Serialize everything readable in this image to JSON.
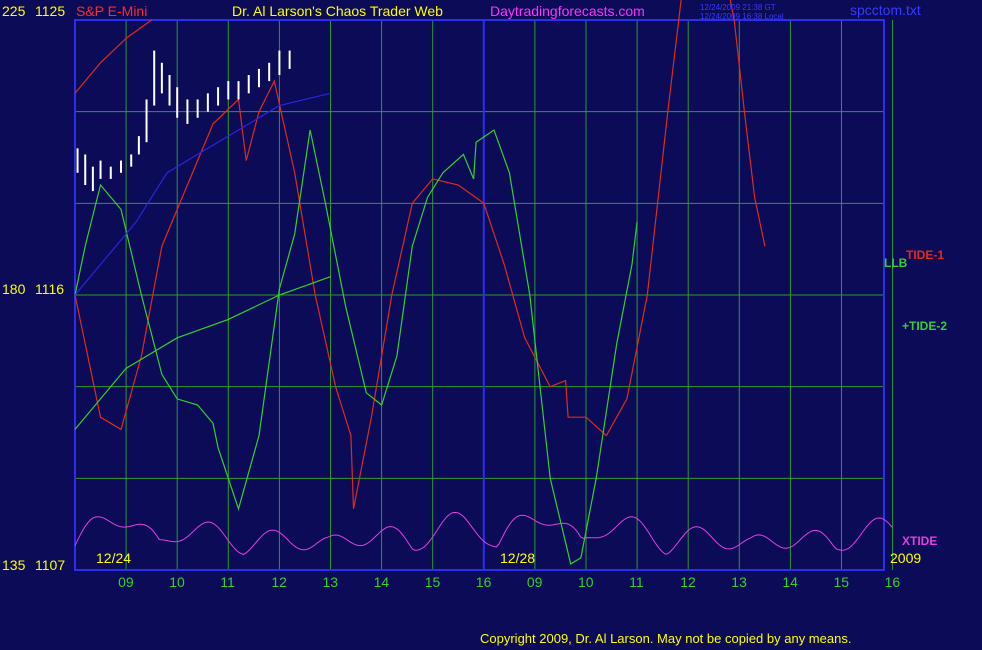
{
  "header": {
    "instrument": "S&P E-Mini",
    "title": "Dr. Al Larson's Chaos Trader Web",
    "site": "Daytradingforecasts.com",
    "timestamp_1": "12/24/2009 21:38 GT",
    "timestamp_2": "12/24/2009 16:38 Local",
    "filename": "spcctom.txt"
  },
  "footer": {
    "copyright": "Copyright 2009, Dr. Al Larson. May not be copied by any means."
  },
  "colors": {
    "background": "#0b0b57",
    "grid": "#2e9a2e",
    "frame": "#2d2df0",
    "tide1": "#e02b1c",
    "tide2": "#34d02f",
    "xtide": "#e040e0",
    "llb": "#2727e0",
    "price": "#ffffff",
    "elements": "#ffff00"
  },
  "chart_data": {
    "type": "line",
    "y_left_labels": [
      {
        "scale": "225",
        "price": "1125"
      },
      {
        "scale": "180",
        "price": "1116"
      },
      {
        "scale": "135",
        "price": "1107"
      }
    ],
    "price_range": [
      1107,
      1125
    ],
    "scale_range": [
      135,
      225
    ],
    "date_labels": [
      "12/24",
      "12/28",
      "2009"
    ],
    "hour_ticks": [
      "09",
      "10",
      "11",
      "12",
      "13",
      "14",
      "15",
      "16",
      "09",
      "10",
      "11",
      "12",
      "13",
      "14",
      "15",
      "16"
    ],
    "tick_index": [
      0,
      1,
      2,
      3,
      4,
      5,
      6,
      7,
      8,
      9,
      10,
      11,
      12,
      13,
      14,
      15
    ],
    "series_labels": {
      "tide1": "TIDE-1",
      "tide2": "+TIDE-2",
      "llb": "LLB",
      "xtide": "XTIDE"
    },
    "tide1": [
      [
        0,
        180
      ],
      [
        0.25,
        170
      ],
      [
        0.5,
        160
      ],
      [
        0.9,
        158
      ],
      [
        1.3,
        170
      ],
      [
        1.7,
        188
      ],
      [
        2.2,
        198
      ],
      [
        2.7,
        208
      ],
      [
        3.2,
        212
      ],
      [
        3.35,
        202
      ],
      [
        3.6,
        210
      ],
      [
        3.9,
        215
      ],
      [
        4.3,
        200
      ],
      [
        4.7,
        180
      ],
      [
        5.1,
        165
      ],
      [
        5.4,
        157
      ],
      [
        5.45,
        145
      ],
      [
        5.8,
        160
      ],
      [
        6.2,
        180
      ],
      [
        6.6,
        195
      ],
      [
        7.0,
        199
      ],
      [
        7.5,
        198
      ],
      [
        8.0,
        195
      ],
      [
        8.4,
        185
      ],
      [
        8.8,
        173
      ],
      [
        9.3,
        165
      ],
      [
        9.6,
        166
      ],
      [
        9.65,
        160
      ],
      [
        10.0,
        160
      ],
      [
        10.4,
        157
      ],
      [
        10.8,
        163
      ],
      [
        11.2,
        180
      ],
      [
        11.6,
        210
      ],
      [
        12.0,
        238
      ],
      [
        12.5,
        242
      ],
      [
        12.9,
        225
      ],
      [
        13.1,
        210
      ],
      [
        13.3,
        196
      ],
      [
        13.5,
        188
      ]
    ],
    "tide2": [
      [
        0,
        180
      ],
      [
        0.2,
        188
      ],
      [
        0.5,
        198
      ],
      [
        0.9,
        194
      ],
      [
        1.3,
        180
      ],
      [
        1.7,
        167
      ],
      [
        2.0,
        163
      ],
      [
        2.4,
        162
      ],
      [
        2.7,
        159
      ],
      [
        2.8,
        155
      ],
      [
        3.2,
        145
      ],
      [
        3.6,
        157
      ],
      [
        4.0,
        181
      ],
      [
        4.3,
        190
      ],
      [
        4.6,
        207
      ],
      [
        4.9,
        195
      ],
      [
        5.3,
        178
      ],
      [
        5.7,
        164
      ],
      [
        6.0,
        162
      ],
      [
        6.3,
        170
      ],
      [
        6.6,
        188
      ],
      [
        6.9,
        196
      ],
      [
        7.2,
        200
      ],
      [
        7.6,
        203
      ],
      [
        7.8,
        199
      ],
      [
        7.85,
        205
      ],
      [
        8.2,
        207
      ],
      [
        8.5,
        200
      ],
      [
        8.9,
        180
      ],
      [
        9.3,
        150
      ],
      [
        9.7,
        136
      ],
      [
        9.9,
        137
      ],
      [
        10.2,
        150
      ],
      [
        10.6,
        172
      ],
      [
        10.9,
        185
      ],
      [
        11.0,
        192
      ]
    ],
    "xtide_hint": "oscillating magenta series along chart bottom",
    "price_bars_note": "price candles from 12/24 09:00 to 13:00"
  }
}
